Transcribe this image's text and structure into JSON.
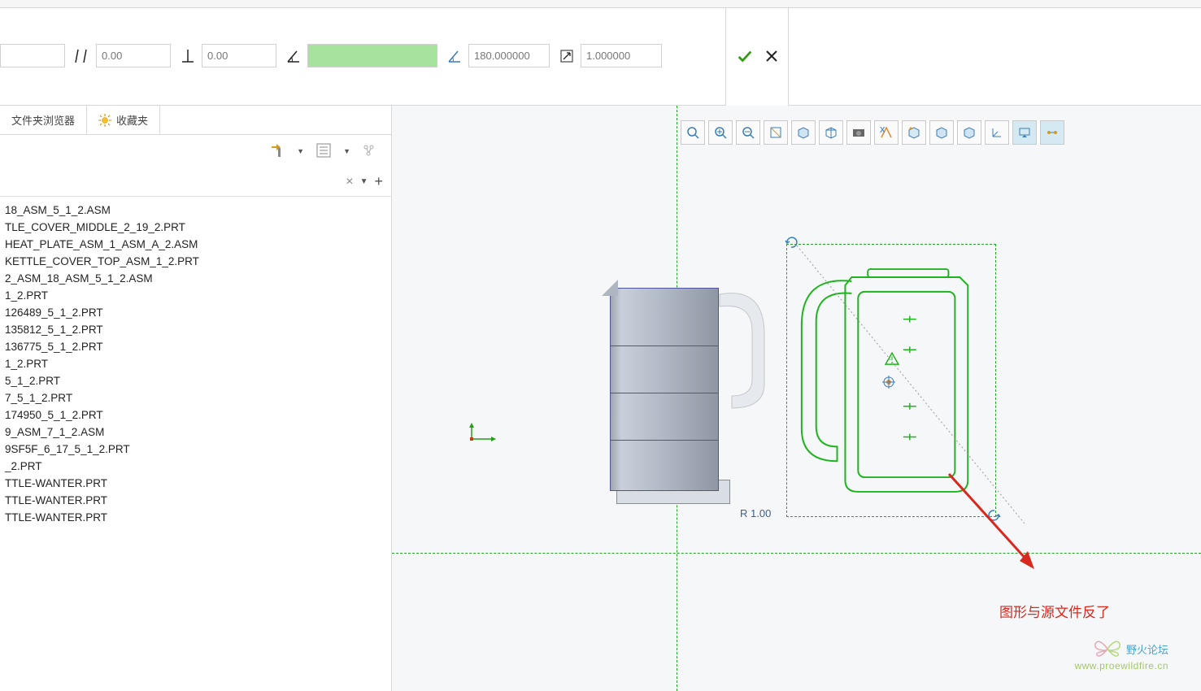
{
  "ribbon": {
    "tabs": [
      "",
      "",
      "",
      "",
      "",
      "",
      "",
      "",
      ""
    ]
  },
  "dimbar": {
    "blank": "",
    "parallel": "0.00",
    "perp": "0.00",
    "angle_highlight": "",
    "angle": "180.000000",
    "scale": "1.000000"
  },
  "subtabs": {
    "folder_browser": "文件夹浏览器",
    "favorites": "收藏夹"
  },
  "tree": {
    "items": [
      "18_ASM_5_1_2.ASM",
      "TLE_COVER_MIDDLE_2_19_2.PRT",
      "HEAT_PLATE_ASM_1_ASM_A_2.ASM",
      "KETTLE_COVER_TOP_ASM_1_2.PRT",
      "2_ASM_18_ASM_5_1_2.ASM",
      "1_2.PRT",
      "126489_5_1_2.PRT",
      "135812_5_1_2.PRT",
      "136775_5_1_2.PRT",
      "1_2.PRT",
      "5_1_2.PRT",
      "7_5_1_2.PRT",
      "174950_5_1_2.PRT",
      "9_ASM_7_1_2.ASM",
      "9SF5F_6_17_5_1_2.PRT",
      "_2.PRT",
      "TTLE-WANTER.PRT",
      "TTLE-WANTER.PRT",
      "TTLE-WANTER.PRT"
    ]
  },
  "rlabel": "R 1.00",
  "annotation": "图形与源文件反了",
  "watermark": {
    "t1": "野火论坛",
    "t2": "www.proewildfire.cn"
  }
}
